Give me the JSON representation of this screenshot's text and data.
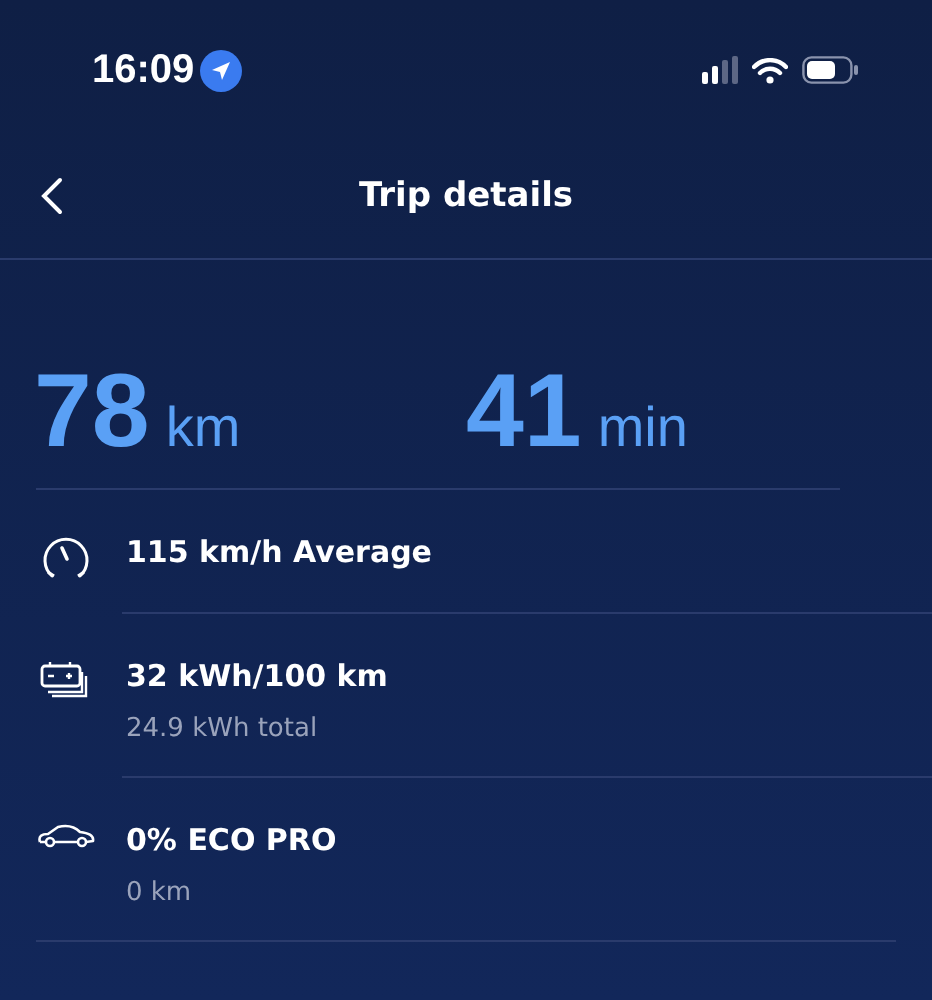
{
  "status_bar": {
    "time": "16:09"
  },
  "header": {
    "title": "Trip details"
  },
  "summary": [
    {
      "value": "78",
      "unit": "km"
    },
    {
      "value": "41",
      "unit": "min"
    }
  ],
  "stats": [
    {
      "kind": "speed",
      "title": "115 km/h Average"
    },
    {
      "kind": "battery",
      "title": "32 kWh/100 km",
      "subtitle": "24.9 kWh total"
    },
    {
      "kind": "car",
      "title": "0% ECO PRO",
      "subtitle": "0 km"
    }
  ]
}
